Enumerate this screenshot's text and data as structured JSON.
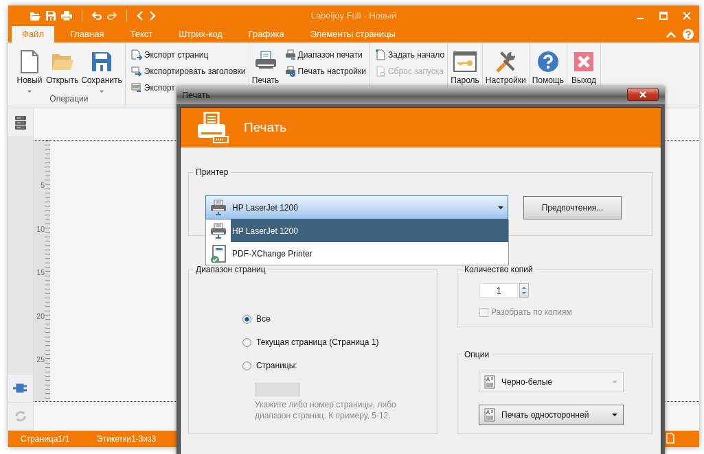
{
  "window": {
    "title": "Labeljoy Full - Новый"
  },
  "menu_tabs": [
    {
      "label": "Файл",
      "selected": true
    },
    {
      "label": "Главная",
      "selected": false
    },
    {
      "label": "Текст",
      "selected": false
    },
    {
      "label": "Штрих-код",
      "selected": false
    },
    {
      "label": "Графика",
      "selected": false
    },
    {
      "label": "Элементы страницы",
      "selected": false
    }
  ],
  "ribbon_groups": [
    {
      "label": "Операции",
      "items": [
        {
          "kind": "large",
          "label": "Новый",
          "dropdown": true
        },
        {
          "kind": "large",
          "label": "Открыть",
          "dropdown": false
        },
        {
          "kind": "large",
          "label": "Сохранить",
          "dropdown": true
        }
      ]
    },
    {
      "items": [
        {
          "kind": "small",
          "label": "Экспорт страниц",
          "disabled": false
        },
        {
          "kind": "small",
          "label": "Экспортировать заголовки",
          "disabled": false
        },
        {
          "kind": "small",
          "label": "Экспорт",
          "disabled": false
        }
      ]
    },
    {
      "items": [
        {
          "kind": "large",
          "label": "Печать",
          "dropdown": false
        },
        {
          "kind": "small",
          "label": "Диапазон печати",
          "disabled": false
        },
        {
          "kind": "small",
          "label": "Печать настройки",
          "disabled": false
        }
      ]
    },
    {
      "items": [
        {
          "kind": "small",
          "label": "Задать начало",
          "disabled": false
        },
        {
          "kind": "small",
          "label": "Сброс запуска",
          "disabled": true
        }
      ]
    },
    {
      "items": [
        {
          "kind": "large",
          "label": "Пароль",
          "dropdown": false
        }
      ]
    },
    {
      "items": [
        {
          "kind": "large",
          "label": "Настройки",
          "dropdown": false
        }
      ]
    },
    {
      "items": [
        {
          "kind": "large",
          "label": "Помощь",
          "dropdown": false
        }
      ]
    },
    {
      "items": [
        {
          "kind": "large",
          "label": "Выход",
          "dropdown": false
        }
      ]
    }
  ],
  "ruler": {
    "labels": [
      "5",
      "10",
      "15",
      "20",
      "25"
    ]
  },
  "status_bar": [
    "Страница1/1",
    "Этикетки1-3из3"
  ],
  "dialog": {
    "title": "Печать",
    "header": "Печать",
    "printer": {
      "label": "Принтер",
      "value": "HP LaserJet 1200",
      "button": "Предпочтения...",
      "options": [
        {
          "label": "HP LaserJet 1200",
          "selected": true
        },
        {
          "label": "PDF-XChange Printer",
          "selected": false
        }
      ]
    },
    "page_range": {
      "label": "Диапазон страниц",
      "radios": [
        {
          "label": "Все",
          "selected": true
        },
        {
          "label": "Текущая страница (Страница 1)",
          "selected": false
        },
        {
          "label": "Страницы:",
          "selected": false
        }
      ],
      "pages_field": {
        "disabled": true
      },
      "hint": "Укажите либо номер страницы, либо диапазон страниц. К примеру, 5-12."
    },
    "copies": {
      "label": "Количество копий",
      "value": "1",
      "collate": {
        "label": "Разобрать по копиям",
        "checked": false,
        "disabled": true
      }
    },
    "options": {
      "label": "Опции",
      "dropdowns": [
        {
          "value": "Черно-белые",
          "disabled": true
        },
        {
          "value": "Печать односторонней",
          "disabled": false
        }
      ]
    }
  }
}
